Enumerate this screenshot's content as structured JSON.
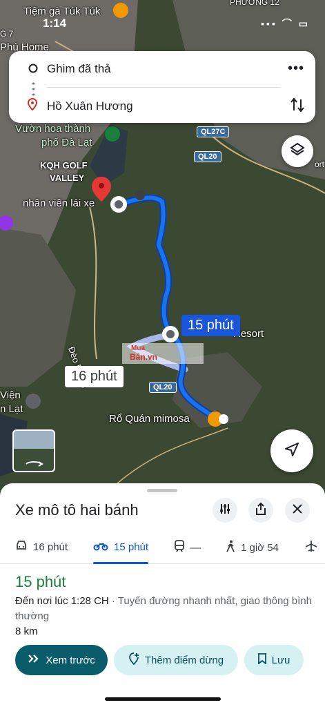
{
  "status_bar": {
    "time": "1:14",
    "icons": "▪▪▪ ⌒ ▭"
  },
  "map_labels": {
    "poi_top": "Tiệm gà Túk Túk",
    "phuong": "PHƯỜNG 12",
    "phu_home": "Phú Home",
    "g7": "G 7",
    "vuon_hoa_1": "Vườn hoa thành",
    "vuon_hoa_2": "phố Đà Lạt",
    "kqh_1": "KQH GOLF",
    "kqh_2": "VALLEY",
    "nhan_vien": "nhân viên lái xe",
    "ql27c": "QL27C",
    "ql20_a": "QL20",
    "ql20_b": "QL20",
    "deo_prenn": "Đèo Prenn",
    "resort": "Resort",
    "vien_1": "Viện",
    "vien_2": "n Lạt",
    "mimosa": "Rổ Quán mimosa",
    "watermark_1": "Mua",
    "watermark_2": "Bán.vn",
    "right_edge": "ort"
  },
  "search": {
    "origin": "Ghim đã thả",
    "destination": "Hồ Xuân Hương"
  },
  "route_badges": {
    "selected": "15 phút",
    "alternate": "16 phút"
  },
  "sheet": {
    "title": "Xe mô tô hai bánh",
    "modes": [
      {
        "icon": "car-icon",
        "label": "16 phút"
      },
      {
        "icon": "motorbike-icon",
        "label": "15 phút"
      },
      {
        "icon": "transit-icon",
        "label": "—"
      },
      {
        "icon": "walk-icon",
        "label": "1 giờ 54"
      },
      {
        "icon": "flight-icon",
        "label": ""
      }
    ],
    "duration": "15 phút",
    "arrival": "Đến nơi lúc 1:28 CH",
    "route_desc": " · Tuyến đường nhanh nhất, giao thông bình thường",
    "distance": "8 km",
    "buttons": {
      "preview": "Xem trước",
      "add_stop": "Thêm điểm dừng",
      "save": "Lưu"
    }
  },
  "colors": {
    "route": "#1a56db",
    "alt_route": "#a8b8e8",
    "duration_green": "#188038",
    "primary_button": "#0b5c6b",
    "tonal_button": "#d6f1f4"
  }
}
